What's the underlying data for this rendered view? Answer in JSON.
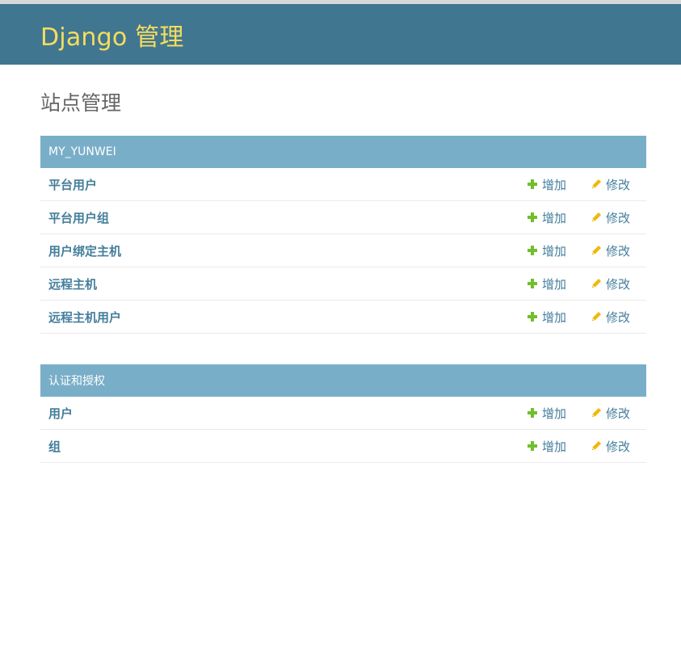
{
  "header": {
    "branding": "Django 管理"
  },
  "page": {
    "title": "站点管理"
  },
  "modules": [
    {
      "caption": "MY_YUNWEI",
      "models": [
        {
          "name": "平台用户",
          "add_label": "增加",
          "change_label": "修改"
        },
        {
          "name": "平台用户组",
          "add_label": "增加",
          "change_label": "修改"
        },
        {
          "name": "用户绑定主机",
          "add_label": "增加",
          "change_label": "修改"
        },
        {
          "name": "远程主机",
          "add_label": "增加",
          "change_label": "修改"
        },
        {
          "name": "远程主机用户",
          "add_label": "增加",
          "change_label": "修改"
        }
      ]
    },
    {
      "caption": "认证和授权",
      "models": [
        {
          "name": "用户",
          "add_label": "增加",
          "change_label": "修改"
        },
        {
          "name": "组",
          "add_label": "增加",
          "change_label": "修改"
        }
      ]
    }
  ],
  "icons": {
    "add": "plus-icon",
    "change": "pencil-icon"
  },
  "colors": {
    "header_bg": "#417690",
    "branding": "#f5dd5d",
    "module_caption_bg": "#79aec8",
    "link": "#447e9b",
    "add_icon": "#70bf2b",
    "change_icon": "#efb80b"
  }
}
